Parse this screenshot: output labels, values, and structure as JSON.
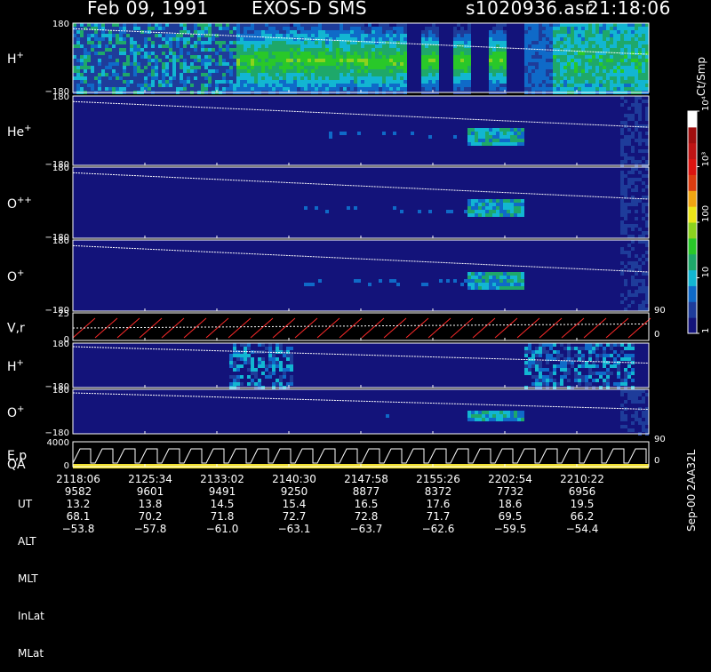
{
  "header": {
    "date": "Feb 09, 1991",
    "instrument": "EXOS-D SMS",
    "file": "s1020936.asr",
    "time": "21:18:06"
  },
  "colorbar": {
    "unit_label": "Ct/Smp",
    "ticks": [
      "1",
      "10",
      "100",
      "10³",
      "10⁴"
    ],
    "colors": [
      "#13137a",
      "#1e3c9a",
      "#0f6ac8",
      "#12b6d2",
      "#1ea86a",
      "#29c829",
      "#8cd21e",
      "#ebe619",
      "#f0a512",
      "#dc3c10",
      "#dc1410",
      "#be1414",
      "#a00f0f",
      "#fefefe"
    ]
  },
  "panels": [
    {
      "label": "H",
      "sup": "+",
      "ytop": "180",
      "ybot": "−180"
    },
    {
      "label": "He",
      "sup": "+",
      "ytop": "180",
      "ybot": "−180"
    },
    {
      "label": "O",
      "sup": "++",
      "ytop": "180",
      "ybot": "−180"
    },
    {
      "label": "O",
      "sup": "+",
      "ytop": "180",
      "ybot": "−180"
    },
    {
      "label": "V,r",
      "sup": "",
      "ytop": "25",
      "ybot": "0",
      "rtop": "90",
      "rbot": "0"
    },
    {
      "label": "H",
      "sup": "+",
      "ytop": "180",
      "ybot": "−180"
    },
    {
      "label": "O",
      "sup": "+",
      "ytop": "180",
      "ybot": "−180"
    },
    {
      "label": "E,p",
      "label2": "QA",
      "sup": "",
      "ytop": "4000",
      "ybot": "0",
      "rtop": "90",
      "rbot": "0"
    }
  ],
  "footer": {
    "row_labels": [
      "UT",
      "ALT",
      "MLT",
      "InLat",
      "MLat"
    ],
    "columns": [
      {
        "ut": "2118:06",
        "alt": "9582",
        "mlt": "13.2",
        "inlat": "68.1",
        "mlat": "−53.8"
      },
      {
        "ut": "2125:34",
        "alt": "9601",
        "mlt": "13.8",
        "inlat": "70.2",
        "mlat": "−57.8"
      },
      {
        "ut": "2133:02",
        "alt": "9491",
        "mlt": "14.5",
        "inlat": "71.8",
        "mlat": "−61.0"
      },
      {
        "ut": "2140:30",
        "alt": "9250",
        "mlt": "15.4",
        "inlat": "72.7",
        "mlat": "−63.1"
      },
      {
        "ut": "2147:58",
        "alt": "8877",
        "mlt": "16.5",
        "inlat": "72.8",
        "mlat": "−63.7"
      },
      {
        "ut": "2155:26",
        "alt": "8372",
        "mlt": "17.6",
        "inlat": "71.7",
        "mlat": "−62.6"
      },
      {
        "ut": "2202:54",
        "alt": "7732",
        "mlt": "18.6",
        "inlat": "69.5",
        "mlat": "−59.5"
      },
      {
        "ut": "2210:22",
        "alt": "6956",
        "mlt": "19.5",
        "inlat": "66.2",
        "mlat": "−54.4"
      }
    ],
    "version": "Sep-00  2AA32L"
  },
  "chart_data": {
    "type": "heatmap",
    "x_ticks": [
      "2118:06",
      "2125:34",
      "2133:02",
      "2140:30",
      "2147:58",
      "2155:26",
      "2202:54",
      "2210:22"
    ],
    "y_range": [
      -180,
      180
    ],
    "color_scale": "log",
    "color_range": [
      1,
      10000
    ],
    "color_unit": "Ct/Smp",
    "panels": [
      "H+",
      "He+",
      "O++",
      "O+",
      "V,r",
      "H+",
      "O+",
      "E,p QA"
    ]
  }
}
